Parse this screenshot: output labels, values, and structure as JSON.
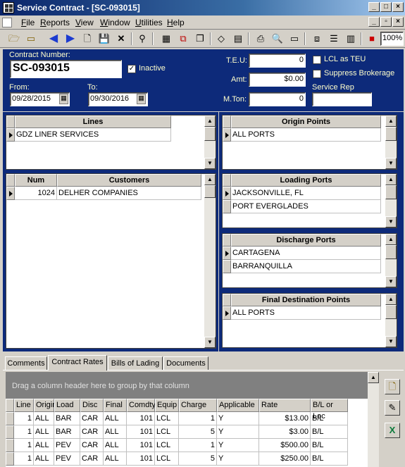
{
  "window": {
    "title": "Service Contract - [SC-093015]"
  },
  "menu": [
    "File",
    "Reports",
    "View",
    "Window",
    "Utilities",
    "Help"
  ],
  "toolbar": {
    "zoom": "100%"
  },
  "header": {
    "contract_label": "Contract Number:",
    "contract_number": "SC-093015",
    "inactive_label": "Inactive",
    "inactive": true,
    "from_label": "From:",
    "from_date": "09/28/2015",
    "to_label": "To:",
    "to_date": "09/30/2016",
    "teu_label": "T.E.U:",
    "teu": "0",
    "amt_label": "Amt:",
    "amt": "$0.00",
    "mton_label": "M.Ton:",
    "mton": "0",
    "lcl_label": "LCL as TEU",
    "suppress_label": "Suppress Brokerage",
    "service_rep_label": "Service Rep",
    "service_rep": ""
  },
  "lines": {
    "header": "Lines",
    "rows": [
      "GDZ LINER SERVICES"
    ]
  },
  "customers": {
    "headers": [
      "Num",
      "Customers"
    ],
    "rows": [
      [
        "1024",
        "DELHER COMPANIES"
      ]
    ]
  },
  "origin_points": {
    "header": "Origin Points",
    "rows": [
      "ALL PORTS"
    ]
  },
  "loading_ports": {
    "header": "Loading Ports",
    "rows": [
      "JACKSONVILLE, FL",
      "PORT EVERGLADES"
    ]
  },
  "discharge_ports": {
    "header": "Discharge Ports",
    "rows": [
      "CARTAGENA",
      "BARRANQUILLA"
    ]
  },
  "final_destination": {
    "header": "Final Destination Points",
    "rows": [
      "ALL PORTS"
    ]
  },
  "tabs": [
    "Comments",
    "Contract Rates",
    "Bills of Lading",
    "Documents"
  ],
  "active_tab": "Contract Rates",
  "rates": {
    "group_hint": "Drag a column header here to group by that column",
    "columns": [
      "Line",
      "Origin",
      "Load",
      "Disc",
      "Final",
      "Comdty",
      "Equip",
      "Charge",
      "Applicable",
      "Rate",
      "B/L or Loc"
    ],
    "rows": [
      [
        "1",
        "ALL",
        "BAR",
        "CAR",
        "ALL",
        "101",
        "LCL",
        "1",
        "Y",
        "$13.00",
        "B/L"
      ],
      [
        "1",
        "ALL",
        "BAR",
        "CAR",
        "ALL",
        "101",
        "LCL",
        "5",
        "Y",
        "$3.00",
        "B/L"
      ],
      [
        "1",
        "ALL",
        "PEV",
        "CAR",
        "ALL",
        "101",
        "LCL",
        "1",
        "Y",
        "$500.00",
        "B/L"
      ],
      [
        "1",
        "ALL",
        "PEV",
        "CAR",
        "ALL",
        "101",
        "LCL",
        "5",
        "Y",
        "$250.00",
        "B/L"
      ]
    ]
  }
}
